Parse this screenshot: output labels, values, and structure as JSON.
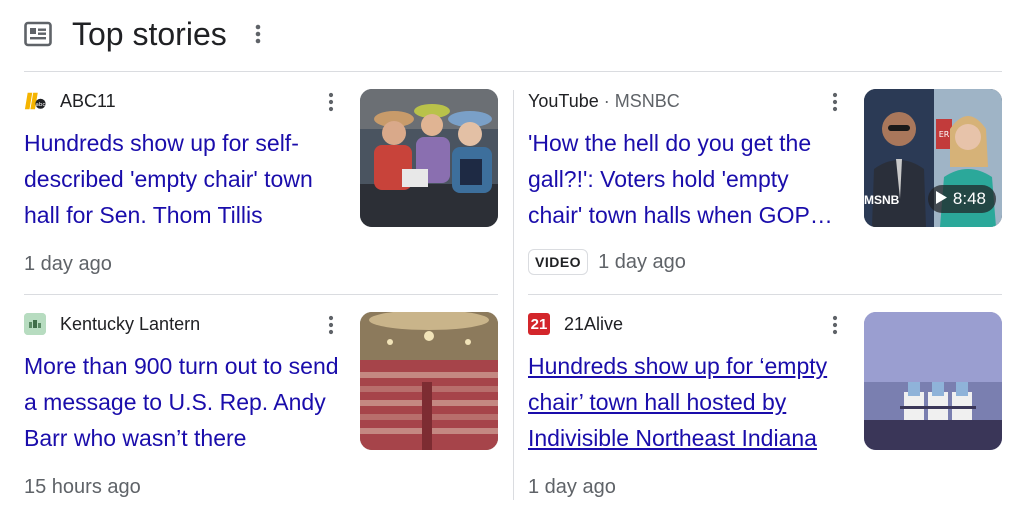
{
  "header": {
    "title": "Top stories",
    "icon": "news-icon",
    "more_icon": "more-vert-icon"
  },
  "colors": {
    "headline": "#1a0dab",
    "meta": "#5f6368",
    "divider": "#dadce0"
  },
  "stories": [
    {
      "source": "ABC11",
      "favicon": "abc11-logo",
      "headline": "Hundreds show up for self-described 'empty chair' town hall for Sen. Thom Tillis",
      "time": "1 day ago"
    },
    {
      "source": "YouTube",
      "source_sub": " · MSNBC",
      "headline": "'How the hell do you get the gall?!': Voters hold 'empty chair' town halls when GOP…",
      "badge": "VIDEO",
      "time": "1 day ago",
      "video_duration": "8:48",
      "thumb_text": "MSNB"
    },
    {
      "source": "Kentucky Lantern",
      "favicon": "kentucky-lantern-logo",
      "headline": "More than 900 turn out to send a message to U.S. Rep. Andy Barr who wasn’t there",
      "time": "15 hours ago"
    },
    {
      "source": "21Alive",
      "favicon": "21alive-logo",
      "favicon_text": "21",
      "headline": "Hundreds show up for ‘empty chair’ town hall hosted by Indivisible Northeast Indiana",
      "time": "1 day ago"
    }
  ]
}
